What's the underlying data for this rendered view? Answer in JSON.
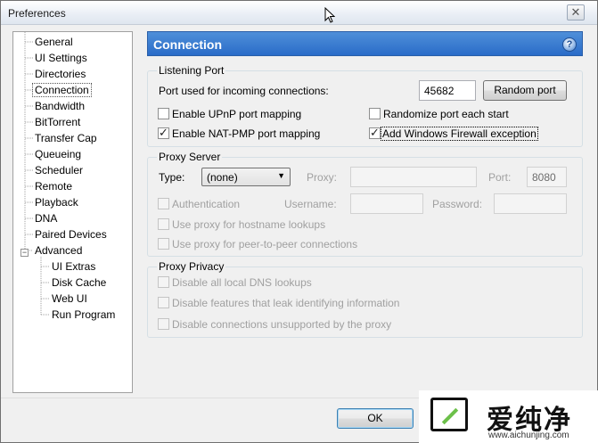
{
  "window": {
    "title": "Preferences",
    "close_glyph": "✕"
  },
  "tree": {
    "items": [
      {
        "label": "General"
      },
      {
        "label": "UI Settings"
      },
      {
        "label": "Directories"
      },
      {
        "label": "Connection",
        "selected": true
      },
      {
        "label": "Bandwidth"
      },
      {
        "label": "BitTorrent"
      },
      {
        "label": "Transfer Cap"
      },
      {
        "label": "Queueing"
      },
      {
        "label": "Scheduler"
      },
      {
        "label": "Remote"
      },
      {
        "label": "Playback"
      },
      {
        "label": "DNA"
      },
      {
        "label": "Paired Devices"
      },
      {
        "label": "Advanced",
        "expanded": true
      },
      {
        "label": "UI Extras"
      },
      {
        "label": "Disk Cache"
      },
      {
        "label": "Web UI"
      },
      {
        "label": "Run Program"
      }
    ],
    "expander_glyph": "−"
  },
  "header": {
    "title": "Connection",
    "help_glyph": "?"
  },
  "listening_port": {
    "group_title": "Listening Port",
    "port_label": "Port used for incoming connections:",
    "port_value": "45682",
    "random_port_button": "Random port",
    "upnp_label": "Enable UPnP port mapping",
    "upnp_checked": false,
    "natpmp_label": "Enable NAT-PMP port mapping",
    "natpmp_checked": true,
    "randomize_label": "Randomize port each start",
    "randomize_checked": false,
    "firewall_label": "Add Windows Firewall exception",
    "firewall_checked": true
  },
  "proxy_server": {
    "group_title": "Proxy Server",
    "type_label": "Type:",
    "type_value": "(none)",
    "proxy_label": "Proxy:",
    "proxy_value": "",
    "port_label": "Port:",
    "port_value": "8080",
    "auth_label": "Authentication",
    "username_label": "Username:",
    "username_value": "",
    "password_label": "Password:",
    "password_value": "",
    "hostname_lookup_label": "Use proxy for hostname lookups",
    "p2p_label": "Use proxy for peer-to-peer connections"
  },
  "proxy_privacy": {
    "group_title": "Proxy Privacy",
    "dns_label": "Disable all local DNS lookups",
    "leak_label": "Disable features that leak identifying information",
    "unsupported_label": "Disable connections unsupported by the proxy"
  },
  "footer": {
    "ok_button": "OK"
  },
  "watermark": {
    "text": "爱纯净",
    "url": "www.aichunjing.com"
  },
  "colors": {
    "header_blue": "#2a6cc8",
    "disabled_text": "#a0a0a0"
  }
}
